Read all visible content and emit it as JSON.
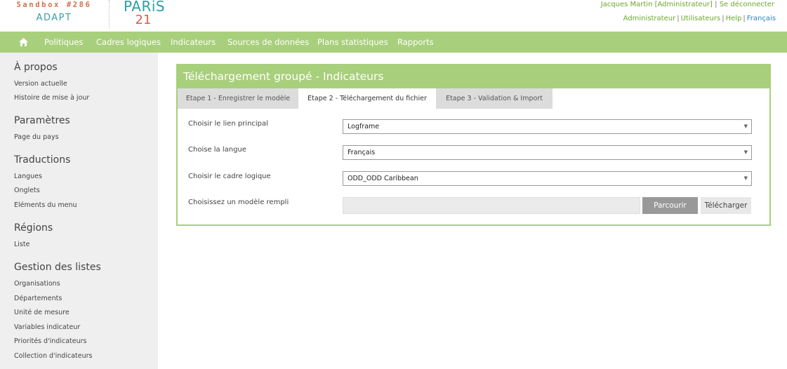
{
  "brand": {
    "sandbox": "Sandbox #286",
    "adapt": "ADAPT",
    "logo_top": "PARiS",
    "logo_bottom": "21"
  },
  "user": {
    "name": "Jacques Martin [Administrateur]",
    "logout": "Se déconnecter"
  },
  "toplinks": {
    "admin": "Administrateur",
    "users": "Utilisateurs",
    "help": "Help",
    "lang": "Français"
  },
  "nav": {
    "home_icon": "home-icon",
    "items": [
      "Politiques",
      "Cadres logiques",
      "Indicateurs",
      "Sources de données",
      "Plans statistiques",
      "Rapports"
    ]
  },
  "sidebar": {
    "sections": [
      {
        "title": "À propos",
        "links": [
          "Version actuelle",
          "Histoire de mise à jour"
        ]
      },
      {
        "title": "Paramètres",
        "links": [
          "Page du pays"
        ]
      },
      {
        "title": "Traductions",
        "links": [
          "Langues",
          "Onglets",
          "Eléments du menu"
        ]
      },
      {
        "title": "Régions",
        "links": [
          "Liste"
        ]
      },
      {
        "title": "Gestion des listes",
        "links": [
          "Organisations",
          "Départements",
          "Unité de mesure",
          "Variables indicateur",
          "Priorités d'indicateurs",
          "Collection d'indicateurs"
        ]
      }
    ]
  },
  "panel": {
    "title": "Téléchargement groupé - Indicateurs",
    "tabs": [
      "Etape  1 - Enregistrer le modèle",
      "Etape  2 - Téléchargement du fichier",
      "Etape  3 - Validation & Import"
    ],
    "active_tab": 1,
    "fields": [
      {
        "label": "Choisir le lien principal",
        "value": "Logframe"
      },
      {
        "label": "Choise la langue",
        "value": "Français"
      },
      {
        "label": "Choisir le cadre logique",
        "value": "ODD_ODD Caribbean"
      }
    ],
    "file": {
      "label": "Choisissez un modèle rempli",
      "value": "",
      "browse": "Parcourir",
      "upload": "Télécharger"
    }
  },
  "colors": {
    "accent": "#a8cf7b",
    "link_green": "#6aa82a",
    "link_blue": "#2a85c6",
    "brand_orange": "#d0704a",
    "brand_teal": "#3a9fa6"
  }
}
